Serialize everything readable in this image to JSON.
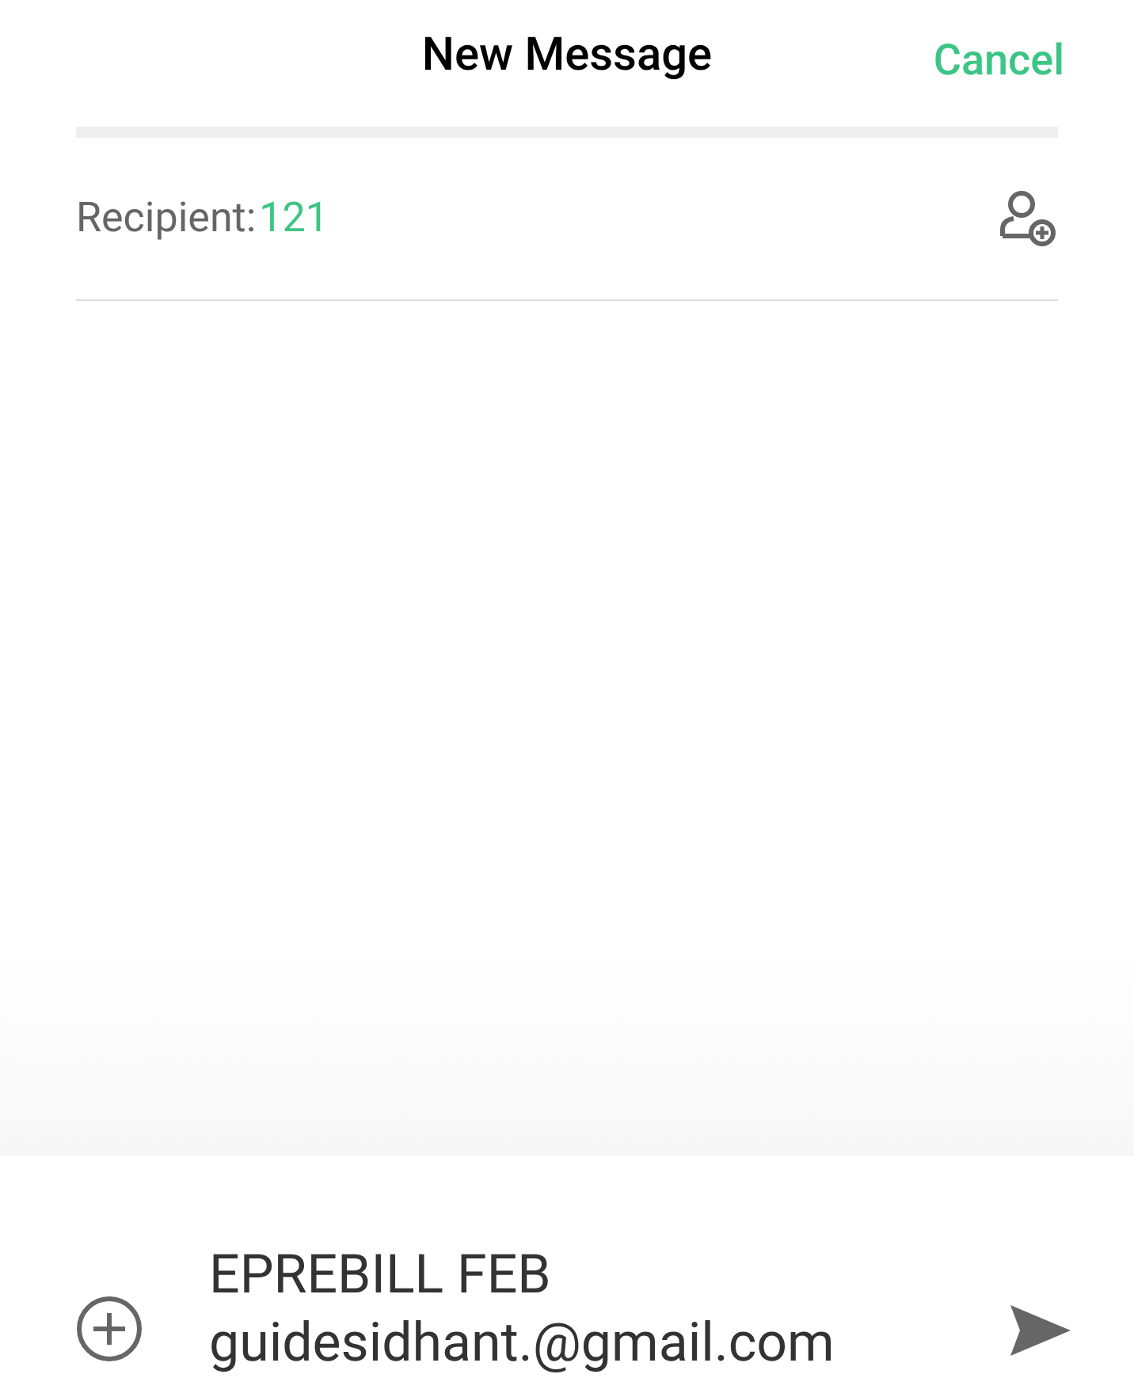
{
  "header": {
    "title": "New Message",
    "cancel": "Cancel"
  },
  "recipient": {
    "label": "Recipient:",
    "value": "121"
  },
  "composer": {
    "value": "EPREBILL FEB\nguidesidhant.@gmail.com"
  }
}
